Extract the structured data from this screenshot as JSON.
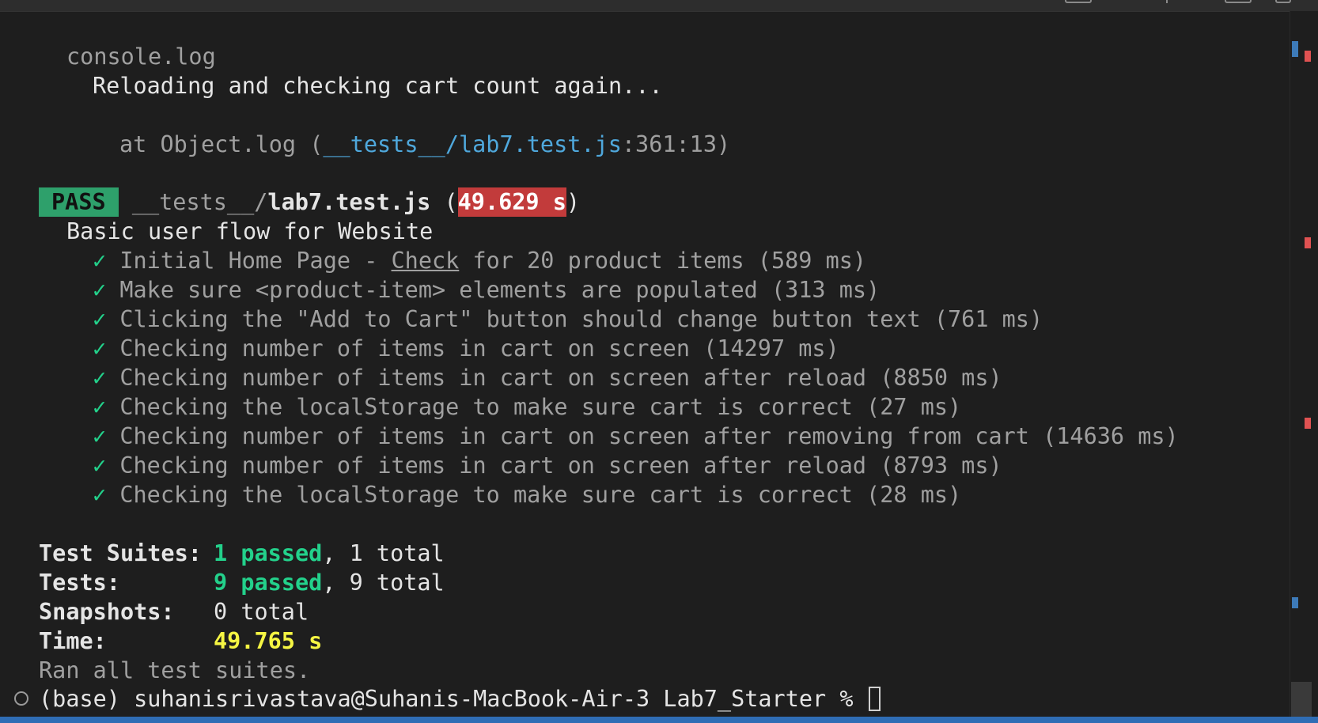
{
  "terminal": {
    "console_log": "console.log",
    "reloading_msg": "Reloading and checking cart count again...",
    "at_prefix": "at Object.log (",
    "at_link": "__tests__/lab7.test.js",
    "at_suffix": ":361:13)",
    "pass_label": "PASS",
    "file_dir": "__tests__/",
    "file_name": "lab7.test.js",
    "paren_open": " (",
    "suite_time": "49.629 s",
    "paren_close": ")",
    "describe_title": "Basic user flow for Website",
    "check_mark": "✓",
    "test_1_pre": "Initial Home Page - ",
    "test_1_check": "Check",
    "test_1_post": " for 20 product items (589 ms)",
    "tests": [
      "Make sure <product-item> elements are populated (313 ms)",
      "Clicking the \"Add to Cart\" button should change button text (761 ms)",
      "Checking number of items in cart on screen (14297 ms)",
      "Checking number of items in cart on screen after reload (8850 ms)",
      "Checking the localStorage to make sure cart is correct (27 ms)",
      "Checking number of items in cart on screen after removing from cart (14636 ms)",
      "Checking number of items in cart on screen after reload (8793 ms)",
      "Checking the localStorage to make sure cart is correct (28 ms)"
    ],
    "summary": {
      "suites_label": "Test Suites:",
      "suites_passed": "1 passed",
      "suites_total": ", 1 total",
      "tests_label": "Tests:",
      "tests_passed": "9 passed",
      "tests_total": ", 9 total",
      "snapshots_label": "Snapshots:",
      "snapshots_value": "0 total",
      "time_label": "Time:",
      "time_value": "49.765 s"
    },
    "ran_all": "Ran all test suites.",
    "prompt": "(base) suhanisrivastava@Suhanis-MacBook-Air-3 Lab7_Starter % "
  },
  "colors": {
    "background": "#1e1e1e",
    "pass_badge": "#2ea06b",
    "time_badge": "#c23b3b",
    "success_green": "#23d18b",
    "time_yellow": "#f5f543",
    "link_blue": "#4fa8dc",
    "statusbar": "#2f6db5"
  }
}
